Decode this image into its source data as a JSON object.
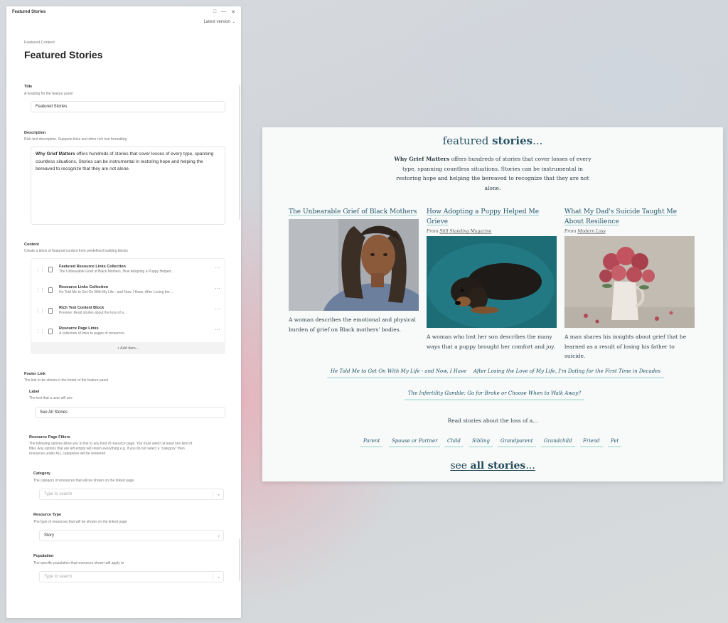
{
  "window": {
    "title": "Featured Stories",
    "version_label": "Latest version"
  },
  "editor": {
    "overline": "Featured Content",
    "heading": "Featured Stories",
    "title_field": {
      "label": "Title",
      "hint": "A heading for the feature panel",
      "value": "Featured Stories"
    },
    "description_field": {
      "label": "Description",
      "hint": "Rich text description. Supports links and other rich text formatting",
      "bold": "Why Grief Matters",
      "rest": " offers hundreds of stories that cover losses of every type, spanning countless situations. Stories can be instrumental in restoring hope and helping the bereaved to recognize that they are not alone."
    },
    "content": {
      "label": "Content",
      "hint": "Create a block of featured content from predefined building blocks",
      "blocks": [
        {
          "title": "Featured Resource Links Collection",
          "subtitle": "The Unbearable Grief of Black Mothers, How Adopting a Puppy Helped..."
        },
        {
          "title": "Resource Links Collection",
          "subtitle": "He Told Me to Get On With My Life - and Now, I Have, After Losing the ..."
        },
        {
          "title": "Rich Text Content Block",
          "subtitle": "Preview: Read stories about the loss of a..."
        },
        {
          "title": "Resource Page Links",
          "subtitle": "A collection of links to pages of resources"
        }
      ],
      "add_item": "+ Add item..."
    },
    "footer_link": {
      "label": "Footer Link",
      "hint": "The link to be shown in the footer of the feature panel",
      "sub_label": "Label",
      "sub_hint": "The text that a user will see",
      "sub_value": "See All Stories",
      "filters_label": "Resource Page Filters",
      "filters_hint": "The following options allow you to link to any kind of resource page. You must select at least one kind of filter. Any options that are left empty will return everything e.g. if you do not select a \"category\" then resources under ALL categories will be rendered",
      "category": {
        "label": "Category",
        "hint": "The category of resources that will be shown on the linked page",
        "placeholder": "Type to search"
      },
      "resource_type": {
        "label": "Resource Type",
        "hint": "The type of resources that will be shown on the linked page",
        "value": "Story"
      },
      "population": {
        "label": "Population",
        "hint": "The specific population that resources shown will apply to",
        "placeholder": "Type to search"
      }
    }
  },
  "preview": {
    "title_light": "featured ",
    "title_bold": "stories",
    "title_tail": "...",
    "desc_bold": "Why Grief Matters",
    "desc_rest": " offers hundreds of stories that cover losses of every type, spanning countless situations. Stories can be instrumental in restoring hope and helping the bereaved to recognize that they are not alone.",
    "stories": [
      {
        "title": "The Unbearable Grief of Black Mothers",
        "source": "",
        "caption": "A woman describes the emotional and physical burden of grief on Black mothers' bodies."
      },
      {
        "title": "How Adopting a Puppy Helped Me Grieve",
        "source_prefix": "From ",
        "source": "Still Standing Magazine",
        "caption": "A woman who lost her son describes the many ways that a puppy brought her comfort and joy."
      },
      {
        "title": "What My Dad's Suicide Taught Me About Resilience",
        "source_prefix": "From ",
        "source": "Modern Loss",
        "caption": "A man shares his insights about grief that he learned as a result of losing his father to suicide."
      }
    ],
    "links": [
      "He Told Me to Get On With My Life - and Now, I Have",
      "After Losing the Love of My Life, I'm Dating for the First Time in Decades",
      "The Infertility Gamble: Go for Broke or Choose When to Walk Away?"
    ],
    "read_loss": "Read stories about the loss of a...",
    "tags": [
      "Parent",
      "Spouse or Partner",
      "Child",
      "Sibling",
      "Grandparent",
      "Grandchild",
      "Friend",
      "Pet"
    ],
    "see_light": "see ",
    "see_bold": "all stories",
    "see_tail": "..."
  },
  "colors": {
    "accent": "#1f5368",
    "underline": "#c8e6e2",
    "panel_bg": "#f8faf9"
  }
}
